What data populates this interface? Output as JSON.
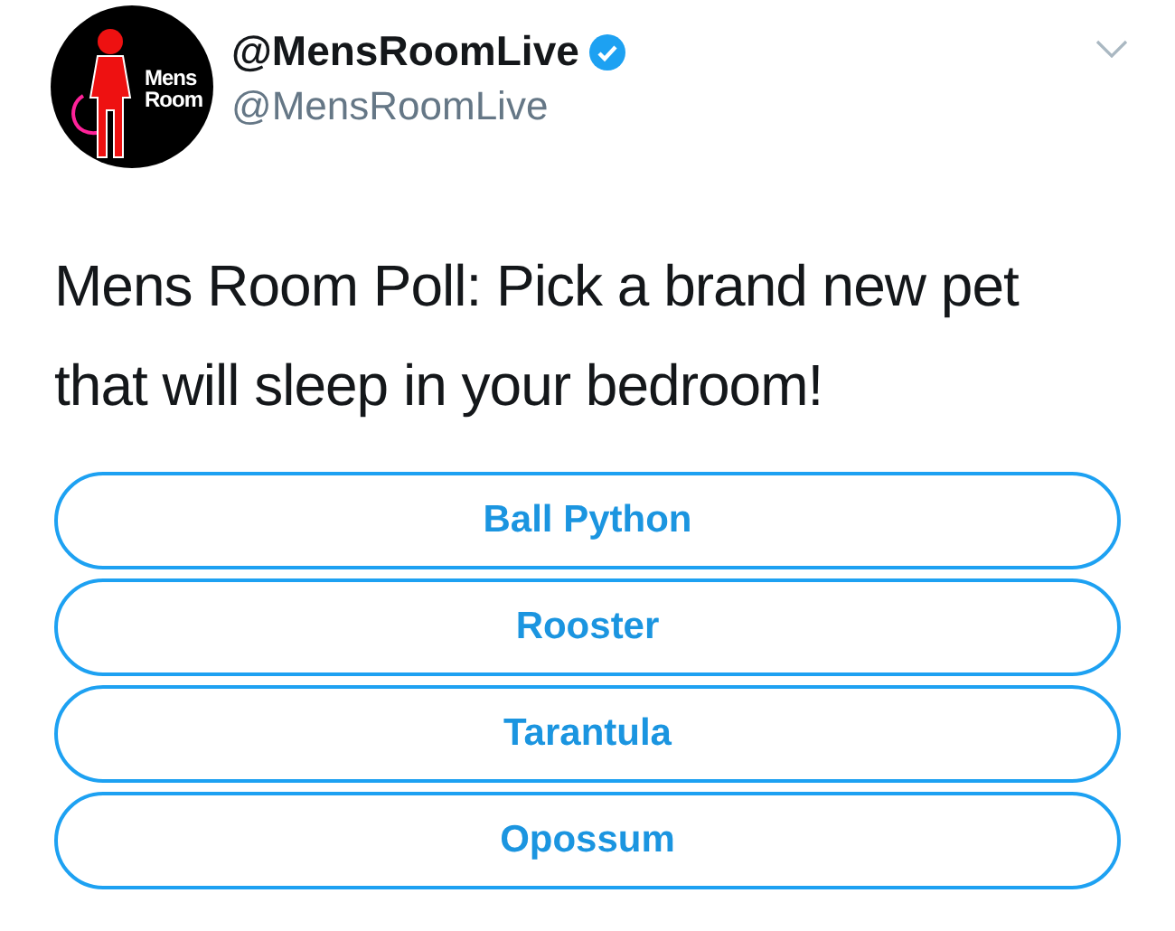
{
  "author": {
    "display_name": "@MensRoomLive",
    "verified": true,
    "handle": "@MensRoomLive",
    "avatar_text": [
      "Mens",
      "Room"
    ]
  },
  "tweet_text": "Mens Room Poll: Pick a brand new pet that will sleep in your bedroom!",
  "poll": {
    "options": [
      {
        "label": "Ball Python"
      },
      {
        "label": "Rooster"
      },
      {
        "label": "Tarantula"
      },
      {
        "label": "Opossum"
      }
    ]
  }
}
